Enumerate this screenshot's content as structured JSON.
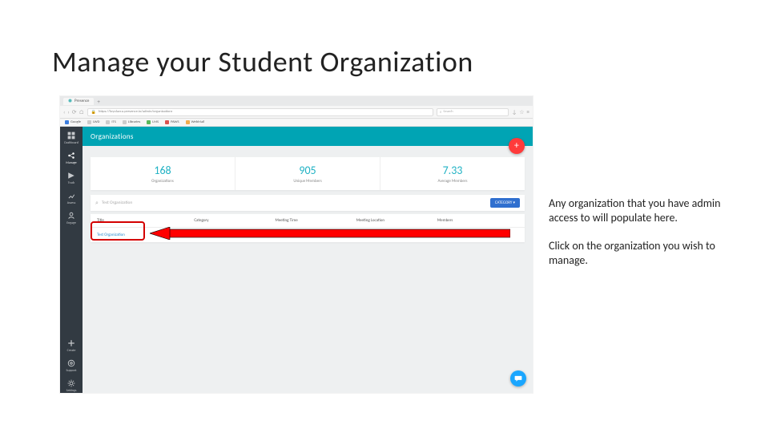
{
  "slide": {
    "title": "Manage your Student Organization"
  },
  "annotations": {
    "p1": "Any organization that you have admin access to will populate here.",
    "p2": "Click on the organization you wish to manage."
  },
  "browser": {
    "tab_title": "Presence",
    "newtab": "+",
    "url": "https://loyolavcu.presence.io/admin/organizations",
    "search_placeholder": "Search",
    "bookmarks": [
      {
        "label": "Google",
        "cls": "bm-blue"
      },
      {
        "label": "LWD",
        "cls": ""
      },
      {
        "label": "ITS",
        "cls": ""
      },
      {
        "label": "Libraries",
        "cls": ""
      },
      {
        "label": "LMS",
        "cls": "bm-green"
      },
      {
        "label": "PAWS",
        "cls": "bm-red"
      },
      {
        "label": "WebMail",
        "cls": "bm-yellow"
      }
    ]
  },
  "sidebar": {
    "items": [
      {
        "name": "dashboard",
        "label": "Dashboard"
      },
      {
        "name": "manage",
        "label": "Manage",
        "active": true
      },
      {
        "name": "track",
        "label": "Track"
      },
      {
        "name": "assess",
        "label": "Assess"
      },
      {
        "name": "engage",
        "label": "Engage"
      }
    ],
    "bottom": [
      {
        "name": "create",
        "label": "Create"
      },
      {
        "name": "support",
        "label": "Support"
      },
      {
        "name": "settings",
        "label": "Settings"
      }
    ]
  },
  "header": {
    "title": "Organizations",
    "fab": "+"
  },
  "stats": [
    {
      "num": "168",
      "label": "Organizations"
    },
    {
      "num": "905",
      "label": "Unique Members"
    },
    {
      "num": "7.33",
      "label": "Average Members"
    }
  ],
  "search": {
    "value": "Test Organization",
    "category_btn": "CATEGORY ▾"
  },
  "table": {
    "columns": [
      "Title",
      "Category",
      "Meeting Time",
      "Meeting Location",
      "Members"
    ],
    "rows": [
      {
        "title": "Test Organization",
        "category": "",
        "meeting_time": "",
        "meeting_location": "",
        "members": ""
      }
    ]
  },
  "colors": {
    "teal": "#00a4b4",
    "red": "#d40000",
    "fab_red": "#ff3b3b",
    "link": "#2b8dcf",
    "arrow_fill": "#ff0000"
  }
}
